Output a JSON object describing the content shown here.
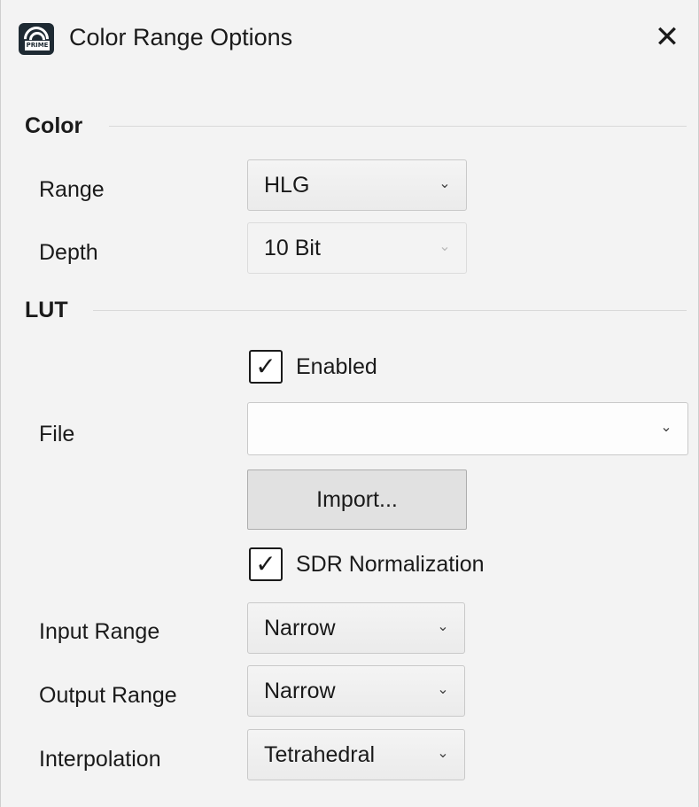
{
  "window": {
    "title": "Color Range Options",
    "app_icon_text": "PRIME",
    "close_glyph": "✕"
  },
  "color": {
    "section_label": "Color",
    "range_label": "Range",
    "range_value": "HLG",
    "depth_label": "Depth",
    "depth_value": "10 Bit"
  },
  "lut": {
    "section_label": "LUT",
    "enabled_label": "Enabled",
    "enabled_checked": true,
    "file_label": "File",
    "file_value": "",
    "import_label": "Import...",
    "sdr_label": "SDR Normalization",
    "sdr_checked": true,
    "input_range_label": "Input Range",
    "input_range_value": "Narrow",
    "output_range_label": "Output Range",
    "output_range_value": "Narrow",
    "interpolation_label": "Interpolation",
    "interpolation_value": "Tetrahedral"
  },
  "glyphs": {
    "chevron": "⌄",
    "check": "✓"
  }
}
